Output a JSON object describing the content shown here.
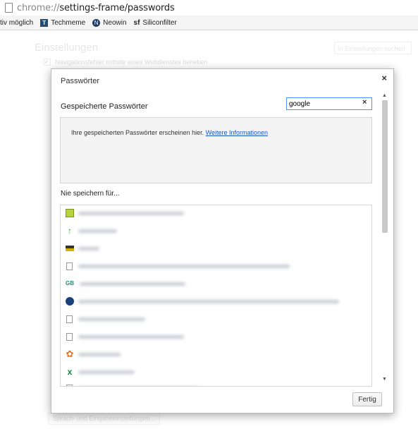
{
  "browser": {
    "url_scheme": "chrome://",
    "url_path": "settings-frame/passwords",
    "bookmarks": [
      {
        "label": "tiv möglich",
        "icon": "none"
      },
      {
        "label": "Techmeme",
        "icon": "techmeme-icon"
      },
      {
        "label": "Neowin",
        "icon": "neowin-icon"
      },
      {
        "label": "Siliconfilter",
        "icon": "siliconfilter-icon"
      }
    ]
  },
  "settings_bg": {
    "title": "Einstellungen",
    "search_placeholder": "In Einstellungen suchen",
    "first_option": "Navigationsfehler mithilfe eines Webdienstes beheben",
    "bottom_button": "Sprach- und Eingabeeinstellungen..."
  },
  "dialog": {
    "title": "Passwörter",
    "close_symbol": "×",
    "saved_label": "Gespeicherte Passwörter",
    "search_value": "google",
    "clear_symbol": "×",
    "empty_message": "Ihre gespeicherten Passwörter erscheinen hier.",
    "more_info_link": "Weitere Informationen",
    "never_label": "Nie speichern für...",
    "done_button": "Fertig",
    "never_sites": [
      {
        "icon": "b-favicon",
        "blurred": true
      },
      {
        "icon": "green-arrow-favicon",
        "blurred": true
      },
      {
        "icon": "striped-favicon",
        "blurred": true
      },
      {
        "icon": "generic-page-icon",
        "blurred": true
      },
      {
        "icon": "gb-favicon",
        "blurred": true
      },
      {
        "icon": "blue-circle-favicon",
        "blurred": true
      },
      {
        "icon": "generic-page-icon",
        "blurred": true
      },
      {
        "icon": "generic-page-icon",
        "blurred": true
      },
      {
        "icon": "flower-favicon",
        "blurred": true
      },
      {
        "icon": "xing-favicon",
        "blurred": true
      },
      {
        "icon": "generic-page-icon",
        "blurred": true
      }
    ]
  }
}
